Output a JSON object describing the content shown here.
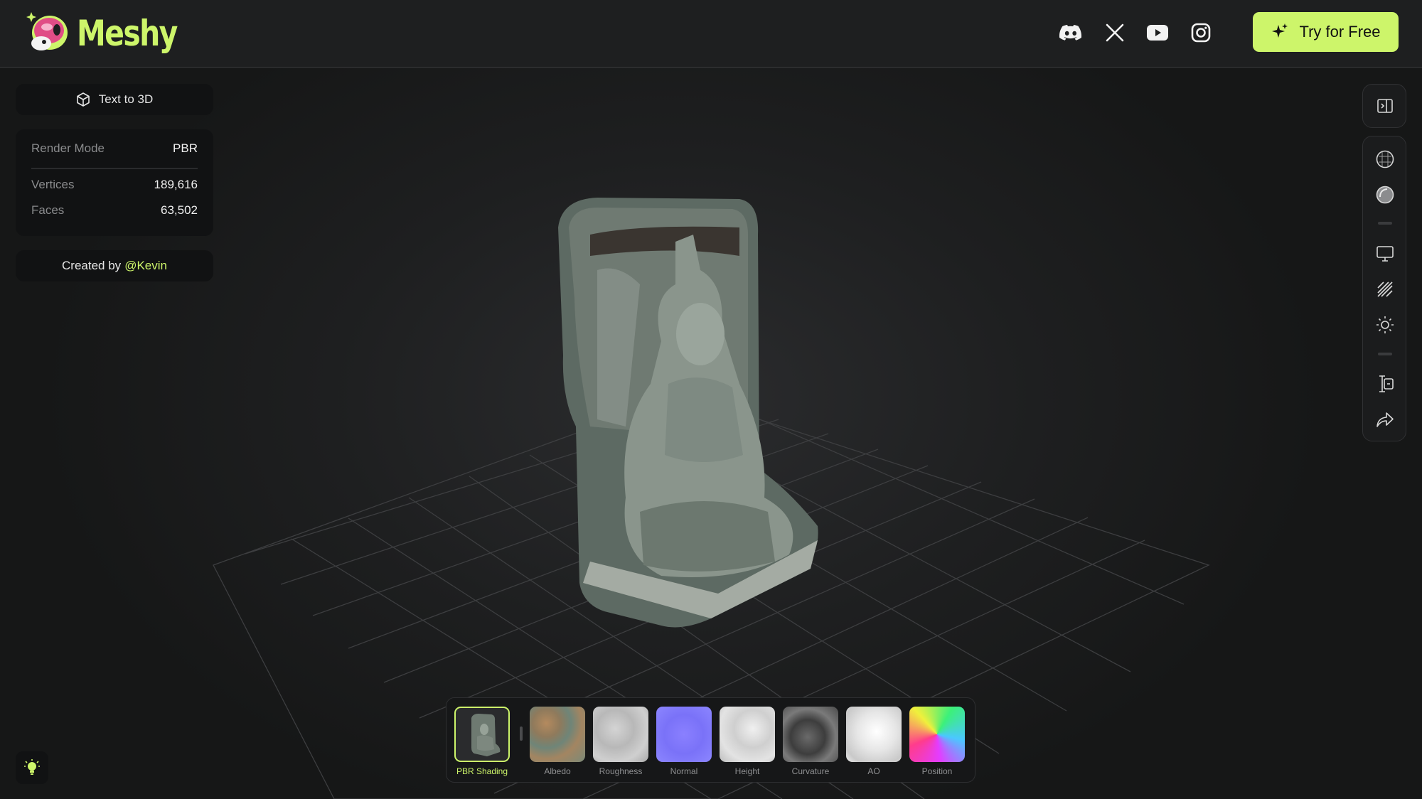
{
  "brand": {
    "name": "Meshy",
    "accent": "#cdf56a"
  },
  "header": {
    "social": [
      "discord-icon",
      "x-icon",
      "youtube-icon",
      "instagram-icon"
    ],
    "cta_label": "Try for Free"
  },
  "left": {
    "mode_label": "Text to 3D",
    "stats": {
      "render_mode_label": "Render Mode",
      "render_mode_value": "PBR",
      "vertices_label": "Vertices",
      "vertices_value": "189,616",
      "faces_label": "Faces",
      "faces_value": "63,502"
    },
    "creator_prefix": "Created by",
    "creator_user": "@Kevin"
  },
  "toolbar": {
    "top": [
      "panel-toggle-icon"
    ],
    "tools": [
      "wireframe-sphere-icon",
      "shaded-sphere-icon",
      "monitor-icon",
      "hatch-icon",
      "light-sun-icon",
      "uv-compare-icon",
      "share-icon"
    ]
  },
  "textures": [
    {
      "label": "PBR Shading",
      "active": true
    },
    {
      "label": "Albedo"
    },
    {
      "label": "Roughness"
    },
    {
      "label": "Normal"
    },
    {
      "label": "Height"
    },
    {
      "label": "Curvature"
    },
    {
      "label": "AO"
    },
    {
      "label": "Position"
    }
  ]
}
